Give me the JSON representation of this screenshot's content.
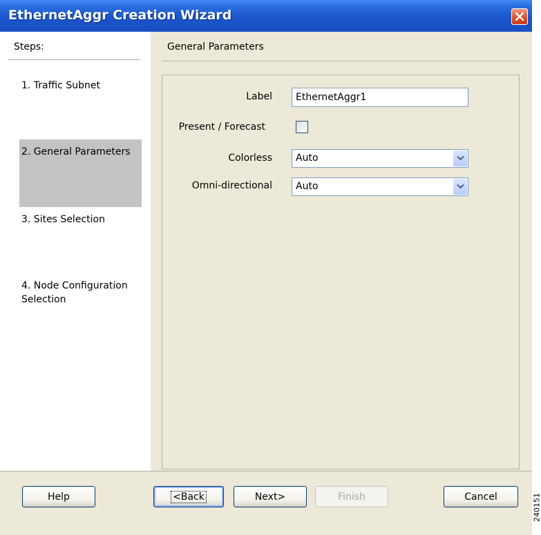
{
  "window": {
    "title": "EthernetAggr Creation Wizard"
  },
  "steps_panel": {
    "header": "Steps:",
    "items": [
      {
        "label": "1. Traffic Subnet",
        "active": false
      },
      {
        "label": "2. General Parameters",
        "active": true
      },
      {
        "label": "3. Sites Selection",
        "active": false
      },
      {
        "label": "4. Node Configuration Selection",
        "active": false
      }
    ]
  },
  "content": {
    "section_title": "General Parameters",
    "fields": {
      "label": {
        "label": "Label",
        "value": "EthernetAggr1"
      },
      "present_forecast": {
        "label": "Present / Forecast",
        "checked": false
      },
      "colorless": {
        "label": "Colorless",
        "value": "Auto"
      },
      "omni_directional": {
        "label": "Omni-directional",
        "value": "Auto"
      }
    }
  },
  "buttons": {
    "help": "Help",
    "back": "<Back",
    "next": "Next>",
    "finish": "Finish",
    "cancel": "Cancel"
  },
  "side_code": "240151",
  "colors": {
    "titlebar": "#1b56cc",
    "panel_bg": "#ece9d8",
    "active_step_bg": "#c3c3c3",
    "close_button": "#d9522d"
  },
  "icons": {
    "close": "close-icon",
    "dropdown": "chevron-down-icon"
  }
}
